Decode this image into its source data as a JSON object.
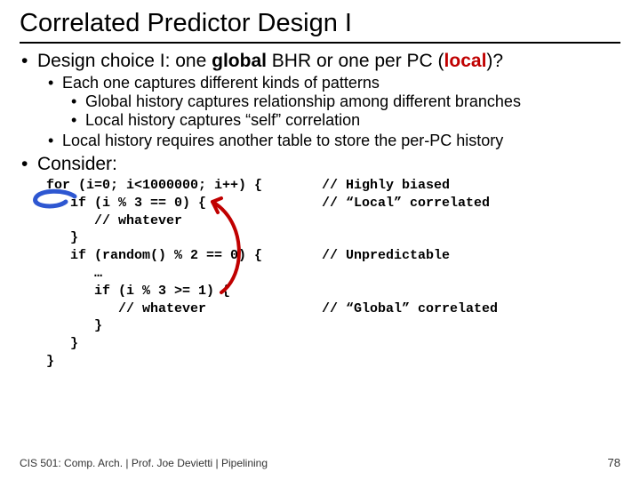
{
  "title": "Correlated Predictor Design I",
  "bullets": {
    "b1_pre": "Design choice I: one ",
    "b1_global": "global",
    "b1_mid": " BHR or one per PC (",
    "b1_local": "local",
    "b1_post": ")?",
    "b1a": "Each one captures different kinds of patterns",
    "b1a_i": "Global history captures relationship among different branches",
    "b1a_ii": "Local history captures “self” correlation",
    "b1b": "Local history requires another table to store the per-PC history",
    "b2": "Consider:"
  },
  "code": {
    "l1": "for (i=0; i<1000000; i++) {",
    "c1": "// Highly biased",
    "l2": "   if (i % 3 == 0) {",
    "c2": "// “Local” correlated",
    "l3": "      // whatever",
    "l4": "   }",
    "l5": "   if (random() % 2 == 0) {",
    "c5": "// Unpredictable",
    "l6": "      …",
    "l7": "      if (i % 3 >= 1) {",
    "l8": "         // whatever",
    "c8": "// “Global” correlated",
    "l9": "      }",
    "l10": "   }",
    "l11": "}"
  },
  "footer": "CIS 501: Comp. Arch.  |  Prof. Joe Devietti  |  Pipelining",
  "page": "78"
}
